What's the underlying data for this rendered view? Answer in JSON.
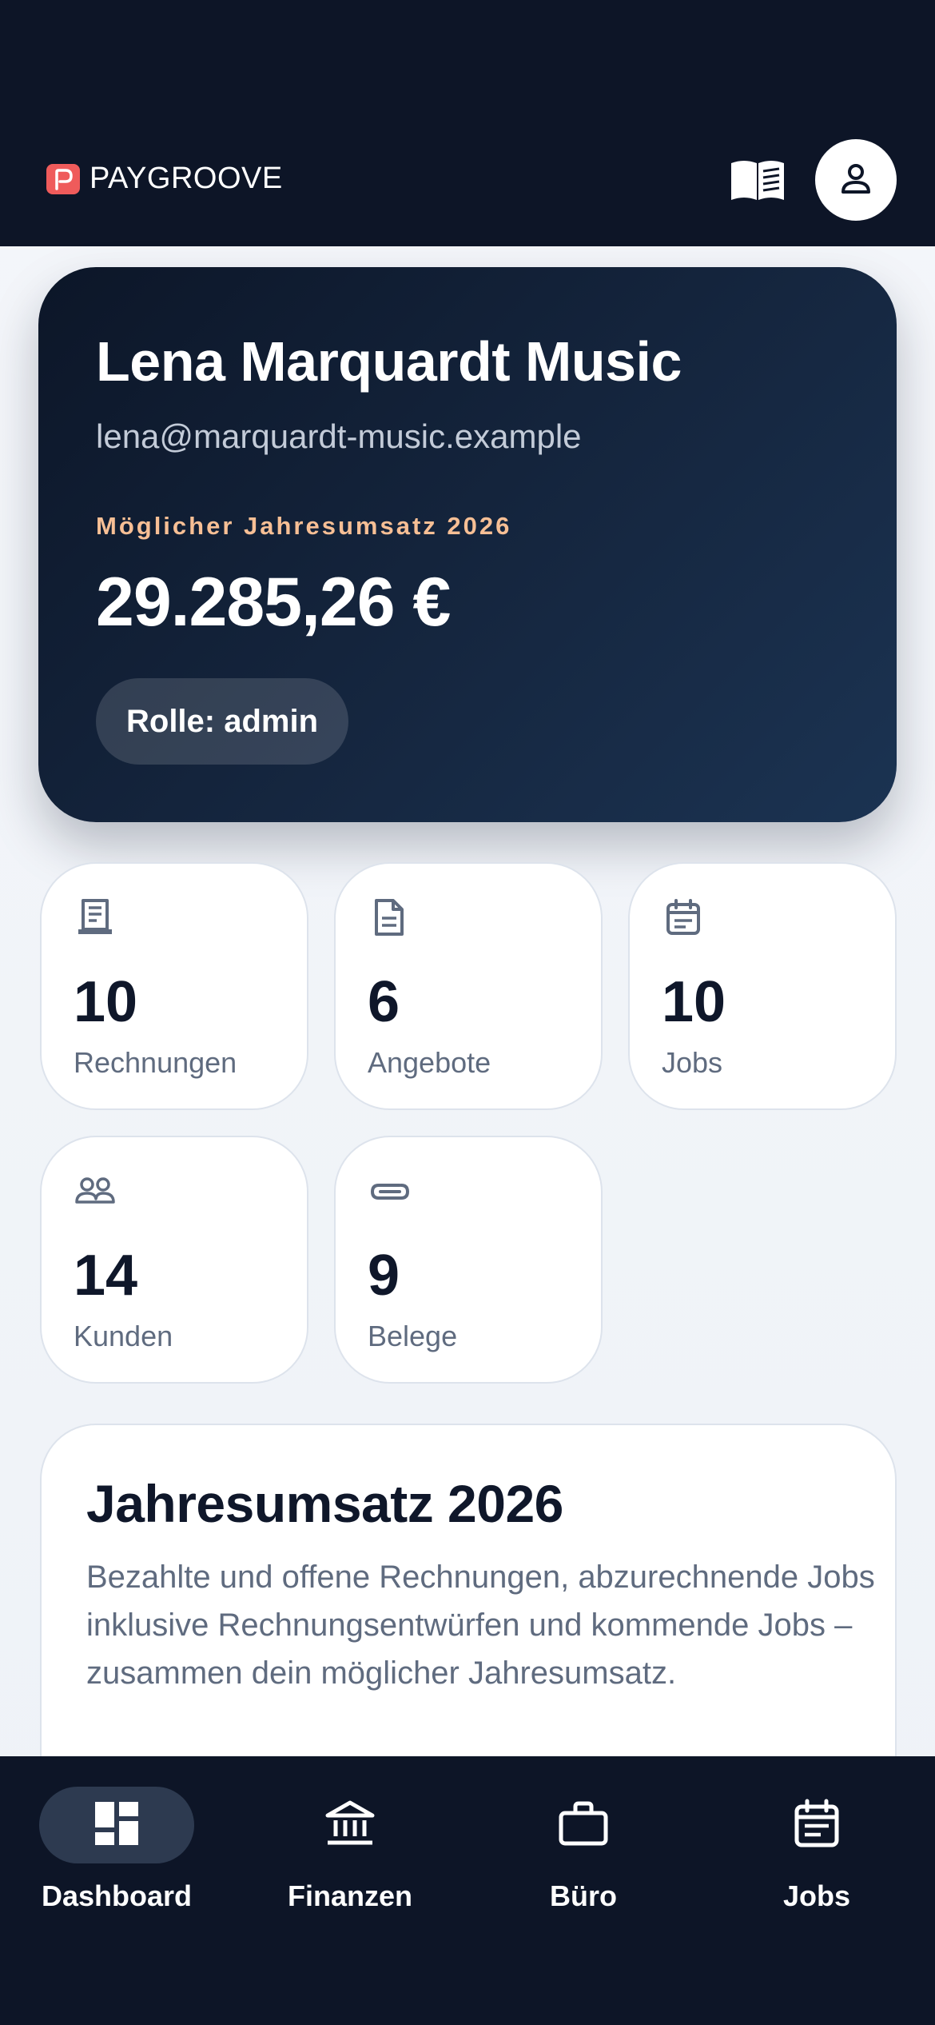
{
  "header": {
    "brand": "PAYGROOVE",
    "colors": {
      "background": "#0d1527",
      "logo_accent": "#ef5b5b"
    },
    "icons": {
      "manual": "book-icon",
      "profile": "user-icon"
    }
  },
  "hero": {
    "name": "Lena Marquardt Music",
    "email": "lena@marquardt-music.example",
    "label": "Möglicher Jahresumsatz 2026",
    "amount": "29.285,26 €",
    "role": "Rolle: admin",
    "label_color": "#f7bf95"
  },
  "stats": [
    {
      "value": "10",
      "label": "Rechnungen",
      "icon": "receipt-icon"
    },
    {
      "value": "6",
      "label": "Angebote",
      "icon": "document-icon"
    },
    {
      "value": "10",
      "label": "Jobs",
      "icon": "calendar-icon"
    },
    {
      "value": "14",
      "label": "Kunden",
      "icon": "users-icon"
    },
    {
      "value": "9",
      "label": "Belege",
      "icon": "paperclip-icon"
    }
  ],
  "revenue": {
    "title": "Jahresumsatz 2026",
    "description": "Bezahlte und offene Rechnungen, abzurechnende Jobs inklusive Rechnungsentwürfen und kommende Jobs – zusammen dein möglicher Jahresumsatz."
  },
  "nav": {
    "active": "Dashboard",
    "items": [
      {
        "label": "Dashboard",
        "icon": "dashboard-icon"
      },
      {
        "label": "Finanzen",
        "icon": "bank-icon"
      },
      {
        "label": "Büro",
        "icon": "briefcase-icon"
      },
      {
        "label": "Jobs",
        "icon": "calendar-icon"
      }
    ]
  }
}
